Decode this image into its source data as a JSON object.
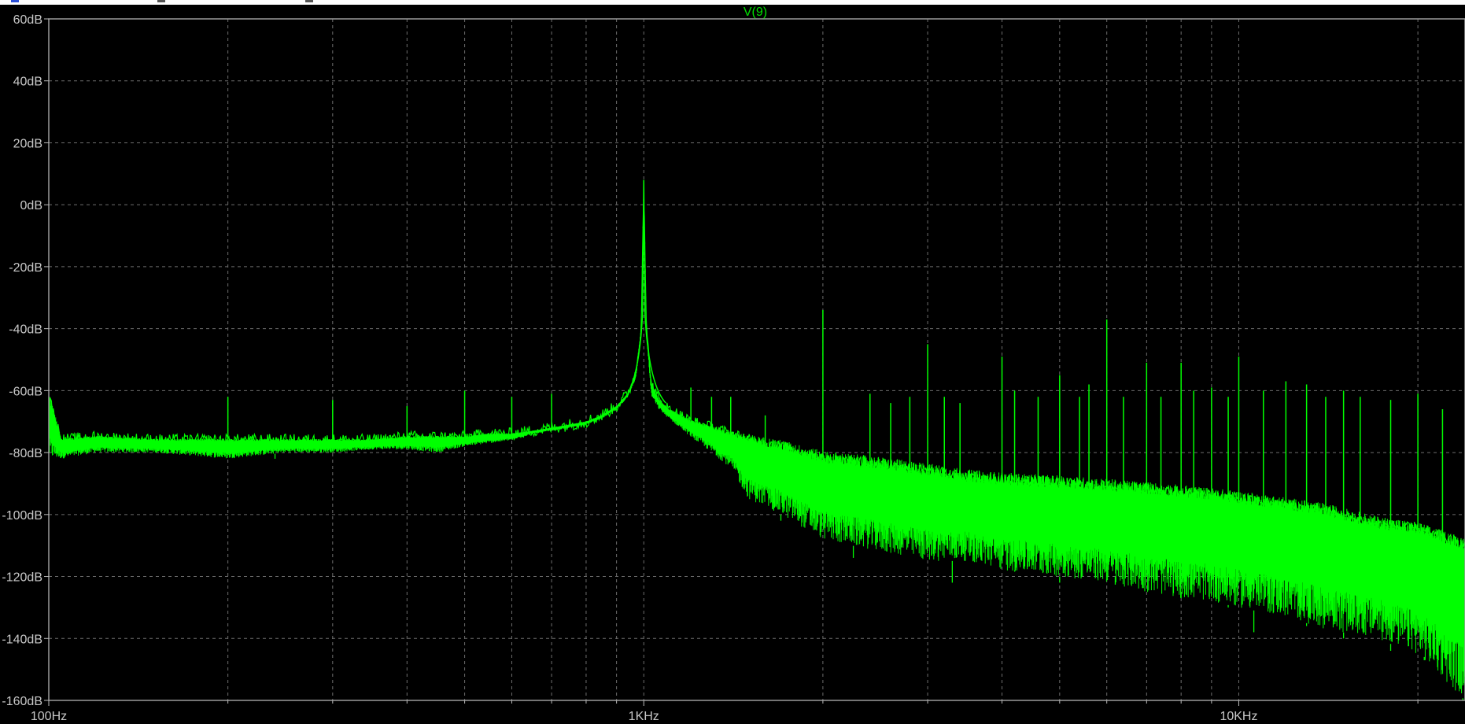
{
  "chart_data": {
    "type": "line",
    "title": "V(9)",
    "xlabel": "",
    "ylabel": "",
    "x_scale": "log",
    "xlim": [
      100,
      24000
    ],
    "ylim": [
      -160,
      60
    ],
    "x_ticks": [
      {
        "value": 100,
        "label": "100Hz"
      },
      {
        "value": 1000,
        "label": "1KHz"
      },
      {
        "value": 10000,
        "label": "10KHz"
      }
    ],
    "y_ticks": [
      {
        "value": 60,
        "label": "60dB"
      },
      {
        "value": 40,
        "label": "40dB"
      },
      {
        "value": 20,
        "label": "20dB"
      },
      {
        "value": 0,
        "label": "0dB"
      },
      {
        "value": -20,
        "label": "-20dB"
      },
      {
        "value": -40,
        "label": "-40dB"
      },
      {
        "value": -60,
        "label": "-60dB"
      },
      {
        "value": -80,
        "label": "-80dB"
      },
      {
        "value": -100,
        "label": "-100dB"
      },
      {
        "value": -120,
        "label": "-120dB"
      },
      {
        "value": -140,
        "label": "-140dB"
      },
      {
        "value": -160,
        "label": "-160dB"
      }
    ],
    "grid": true,
    "series": [
      {
        "name": "V(9)",
        "color": "#00ff00",
        "x": [
          100,
          105,
          120,
          150,
          200,
          250,
          300,
          350,
          400,
          450,
          500,
          550,
          600,
          650,
          700,
          750,
          800,
          850,
          900,
          940,
          970,
          990,
          1000,
          1010,
          1030,
          1060,
          1100,
          1150,
          1200,
          1300,
          1400,
          1500,
          1700,
          2000,
          2500,
          3000,
          3500,
          4000,
          5000,
          6000,
          7000,
          8000,
          9000,
          10000,
          12000,
          14000,
          17000,
          20000,
          24000
        ],
        "y": [
          -62,
          -76,
          -75,
          -76,
          -76,
          -76,
          -76,
          -76,
          -75,
          -75,
          -75,
          -74,
          -74,
          -73,
          -72,
          -71,
          -70,
          -68,
          -65,
          -61,
          -54,
          -40,
          8,
          -40,
          -58,
          -63,
          -66,
          -68,
          -70,
          -72,
          -74,
          -76,
          -78,
          -82,
          -84,
          -86,
          -88,
          -89,
          -90,
          -91,
          -92,
          -93,
          -94,
          -95,
          -97,
          -99,
          -103,
          -105,
          -110
        ],
        "y_min": [
          -82,
          -82,
          -80,
          -80,
          -82,
          -80,
          -80,
          -79,
          -79,
          -80,
          -78,
          -77,
          -76,
          -74,
          -73,
          -72,
          -71,
          -69,
          -66,
          -62,
          -56,
          -42,
          8,
          -42,
          -62,
          -66,
          -69,
          -72,
          -75,
          -80,
          -85,
          -95,
          -100,
          -108,
          -112,
          -115,
          -115,
          -118,
          -120,
          -122,
          -125,
          -127,
          -128,
          -130,
          -133,
          -137,
          -140,
          -145,
          -160
        ],
        "harmonic_peaks": [
          {
            "x": 200,
            "y": -62
          },
          {
            "x": 300,
            "y": -63
          },
          {
            "x": 400,
            "y": -65
          },
          {
            "x": 500,
            "y": -60
          },
          {
            "x": 600,
            "y": -62
          },
          {
            "x": 700,
            "y": -61
          },
          {
            "x": 900,
            "y": -65
          },
          {
            "x": 1200,
            "y": -59
          },
          {
            "x": 1300,
            "y": -62
          },
          {
            "x": 1400,
            "y": -62
          },
          {
            "x": 1600,
            "y": -68
          },
          {
            "x": 2000,
            "y": -34
          },
          {
            "x": 2400,
            "y": -61
          },
          {
            "x": 2600,
            "y": -64
          },
          {
            "x": 2800,
            "y": -62
          },
          {
            "x": 3000,
            "y": -45
          },
          {
            "x": 3200,
            "y": -62
          },
          {
            "x": 3400,
            "y": -64
          },
          {
            "x": 4000,
            "y": -49
          },
          {
            "x": 4200,
            "y": -60
          },
          {
            "x": 4600,
            "y": -62
          },
          {
            "x": 5000,
            "y": -55
          },
          {
            "x": 5400,
            "y": -62
          },
          {
            "x": 5600,
            "y": -58
          },
          {
            "x": 6000,
            "y": -37
          },
          {
            "x": 6400,
            "y": -62
          },
          {
            "x": 7000,
            "y": -51
          },
          {
            "x": 7400,
            "y": -62
          },
          {
            "x": 8000,
            "y": -51
          },
          {
            "x": 8400,
            "y": -60
          },
          {
            "x": 9000,
            "y": -59
          },
          {
            "x": 9600,
            "y": -62
          },
          {
            "x": 10000,
            "y": -49
          },
          {
            "x": 11000,
            "y": -60
          },
          {
            "x": 12000,
            "y": -57
          },
          {
            "x": 13000,
            "y": -58
          },
          {
            "x": 14000,
            "y": -62
          },
          {
            "x": 15000,
            "y": -60
          },
          {
            "x": 16000,
            "y": -62
          },
          {
            "x": 18000,
            "y": -63
          },
          {
            "x": 20000,
            "y": -61
          },
          {
            "x": 22000,
            "y": -66
          }
        ],
        "dips": [
          {
            "x": 101,
            "y": -82
          },
          {
            "x": 240,
            "y": -82
          },
          {
            "x": 1700,
            "y": -102
          },
          {
            "x": 2250,
            "y": -114
          },
          {
            "x": 2500,
            "y": -112
          },
          {
            "x": 3300,
            "y": -122
          },
          {
            "x": 4200,
            "y": -118
          },
          {
            "x": 5000,
            "y": -122
          },
          {
            "x": 6200,
            "y": -120
          },
          {
            "x": 8000,
            "y": -125
          },
          {
            "x": 9600,
            "y": -130
          },
          {
            "x": 10600,
            "y": -138
          },
          {
            "x": 13000,
            "y": -136
          },
          {
            "x": 15000,
            "y": -140
          },
          {
            "x": 18000,
            "y": -144
          },
          {
            "x": 20500,
            "y": -146
          },
          {
            "x": 23800,
            "y": -160
          }
        ]
      }
    ]
  }
}
